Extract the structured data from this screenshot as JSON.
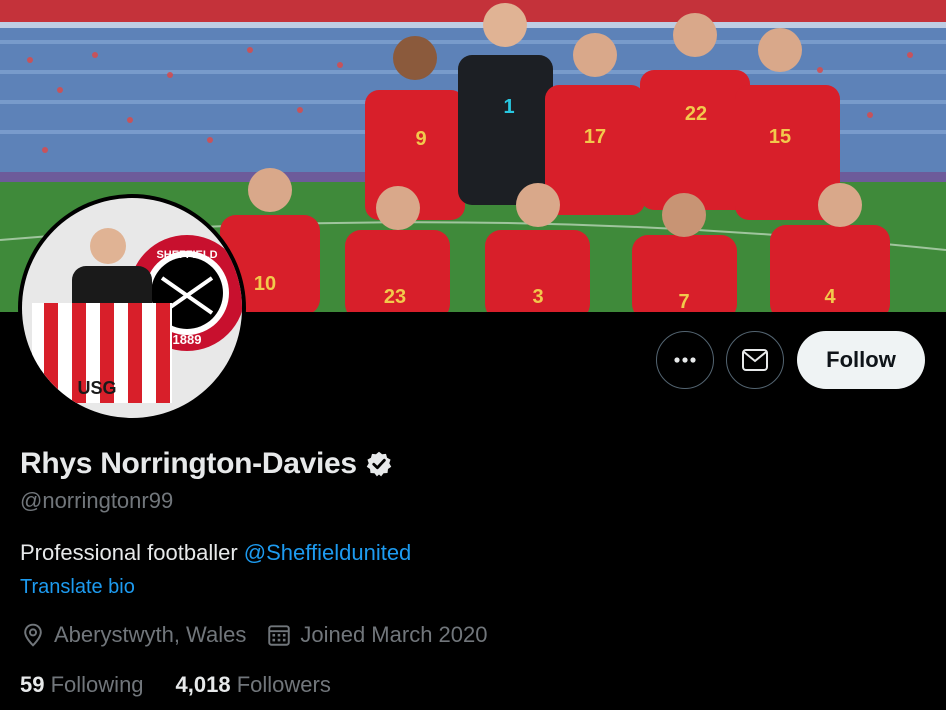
{
  "colors": {
    "background": "#000000",
    "primary_text": "#e7e9ea",
    "secondary_text": "#71767b",
    "link": "#1d9bf0",
    "follow_button_bg": "#eff3f4",
    "kit_red": "#d81f2a"
  },
  "banner": {
    "jersey_numbers": [
      "9",
      "1",
      "17",
      "22",
      "15",
      "10",
      "23",
      "3",
      "7",
      "4"
    ]
  },
  "avatar": {
    "crest_text": "SHEFFIELD",
    "crest_year": "1889",
    "shirt_text": "USG"
  },
  "actions": {
    "more_icon": "more-icon",
    "message_icon": "envelope-icon",
    "follow_label": "Follow"
  },
  "profile": {
    "name": "Rhys Norrington-Davies",
    "verified_icon": "verified-badge-icon",
    "handle": "@norringtonr99",
    "bio_text": "Professional footballer ",
    "bio_mention": "@Sheffieldunited",
    "translate_label": "Translate bio",
    "location": "Aberystwyth, Wales",
    "location_icon": "location-pin-icon",
    "joined": "Joined March 2020",
    "joined_icon": "calendar-icon",
    "following_count": "59",
    "following_label": "Following",
    "followers_count": "4,018",
    "followers_label": "Followers"
  }
}
